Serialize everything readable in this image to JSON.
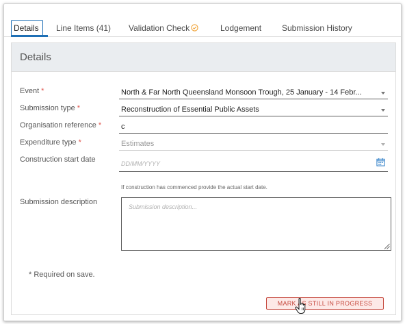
{
  "tabs": [
    {
      "label": "Details",
      "active": true
    },
    {
      "label": "Line Items (41)",
      "active": false
    },
    {
      "label": "Validation Check",
      "active": false,
      "icon": "check-circle-icon",
      "icon_color": "#f0a030"
    },
    {
      "label": "Lodgement",
      "active": false
    },
    {
      "label": "Submission History",
      "active": false
    }
  ],
  "panel": {
    "title": "Details"
  },
  "form": {
    "required_marker": "*",
    "event": {
      "label": "Event",
      "value": "North & Far North Queensland Monsoon Trough, 25 January - 14 Febr..."
    },
    "submission_type": {
      "label": "Submission type",
      "value": "Reconstruction of Essential Public Assets"
    },
    "organisation_reference": {
      "label": "Organisation reference",
      "value": "c"
    },
    "expenditure_type": {
      "label": "Expenditure type",
      "value": "Estimates",
      "disabled": true
    },
    "construction_start_date": {
      "label": "Construction start date",
      "placeholder": "DD/MM/YYYY",
      "hint": "If construction has commenced provide the actual start date."
    },
    "submission_description": {
      "label": "Submission description",
      "placeholder": "Submission description..."
    }
  },
  "required_note": "* Required on save.",
  "actions": {
    "mark_in_progress": "MARK AS STILL IN PROGRESS"
  },
  "colors": {
    "accent": "#1e6fb5",
    "required": "#e0564e",
    "button_border": "#c64a3f",
    "button_bg": "#fde9e7"
  }
}
